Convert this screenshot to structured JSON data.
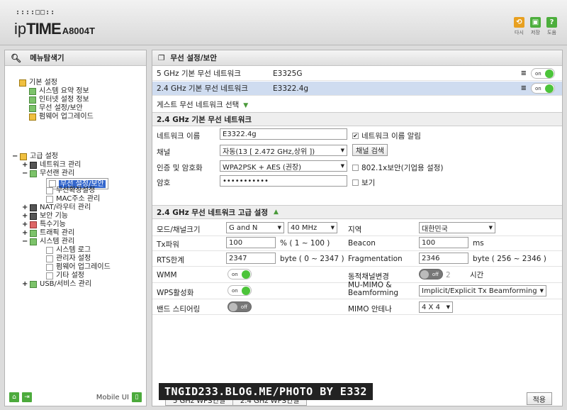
{
  "header": {
    "logo_mark": "::::□□::",
    "logo_brand_prefix": "ip",
    "logo_brand": "TIME",
    "logo_model": "A8004T",
    "buttons": [
      {
        "label": "다시",
        "icon": "refresh-icon",
        "color": "#e8a020"
      },
      {
        "label": "저장",
        "icon": "save-icon",
        "color": "#4cae3c"
      },
      {
        "label": "도움",
        "icon": "help-icon",
        "color": "#4cae3c"
      }
    ]
  },
  "sidebar": {
    "title": "메뉴탐색기",
    "items": [
      {
        "label": "기본 설정",
        "toggle": ""
      },
      {
        "label": "시스템 요약 정보"
      },
      {
        "label": "인터넷 설정 정보"
      },
      {
        "label": "무선 설정/보안"
      },
      {
        "label": "펌웨어 업그레이드"
      },
      {
        "label": "고급 설정",
        "toggle": "−"
      },
      {
        "label": "네트워크 관리",
        "toggle": "+"
      },
      {
        "label": "무선랜 관리",
        "toggle": "−"
      },
      {
        "label": "무선 설정/보안"
      },
      {
        "label": "무선확장설정"
      },
      {
        "label": "MAC주소 관리"
      },
      {
        "label": "NAT/라우터 관리",
        "toggle": "+"
      },
      {
        "label": "보안 기능",
        "toggle": "+"
      },
      {
        "label": "특수기능",
        "toggle": "+"
      },
      {
        "label": "트래픽 관리",
        "toggle": "+"
      },
      {
        "label": "시스템 관리",
        "toggle": "−"
      },
      {
        "label": "시스템 로그"
      },
      {
        "label": "관리자 설정"
      },
      {
        "label": "펌웨어 업그레이드"
      },
      {
        "label": "기타 설정"
      },
      {
        "label": "USB/서비스 관리",
        "toggle": "+"
      }
    ],
    "footer": {
      "mobile_label": "Mobile UI"
    }
  },
  "main": {
    "title": "무선 설정/보안",
    "networks": [
      {
        "band": "5 GHz 기본 무선 네트워크",
        "ssid": "E3325G",
        "toggle": "on"
      },
      {
        "band": "2.4 GHz 기본 무선 네트워크",
        "ssid": "E3322.4g",
        "toggle": "on"
      }
    ],
    "guest_label": "게스트 무선 네트워크 선택",
    "basic_section": {
      "title": "2.4 GHz 기본 무선 네트워크",
      "name_label": "네트워크 이름",
      "name_value": "E3322.4g",
      "broadcast_label": "네트워크 이름 알림",
      "channel_label": "채널",
      "channel_value": "자동(13 [ 2.472 GHz,상위 ])",
      "channel_search_btn": "채널 검색",
      "auth_label": "인증 및 암호화",
      "auth_value": "WPA2PSK + AES (권장)",
      "dot1x_label": "802.1x보안(기업용 설정)",
      "pw_label": "암호",
      "pw_value": "•••••••••••",
      "show_label": "보기"
    },
    "advanced_section": {
      "title": "2.4 GHz 무선 네트워크 고급 설정",
      "mode_label": "모드/채널크기",
      "mode_value": "G and N",
      "width_value": "40 MHz",
      "region_label": "지역",
      "region_value": "대한민국",
      "tx_label": "Tx파워",
      "tx_value": "100",
      "tx_range": "% ( 1 ~ 100 )",
      "beacon_label": "Beacon",
      "beacon_value": "100",
      "beacon_unit": "ms",
      "rts_label": "RTS한계",
      "rts_value": "2347",
      "rts_range": "byte ( 0 ~ 2347 )",
      "frag_label": "Fragmentation",
      "frag_value": "2346",
      "frag_range": "byte ( 256 ~ 2346 )",
      "wmm_label": "WMM",
      "wmm_state": "on",
      "dyn_label": "동적채널변경",
      "dyn_state": "off",
      "dyn_value": "2",
      "dyn_unit": "시간",
      "wps_label": "WPS활성화",
      "wps_state": "on",
      "mumimo_label1": "MU-MIMO &",
      "mumimo_label2": "Beamforming",
      "mumimo_value": "Implicit/Explicit Tx Beamforming",
      "band_label": "밴드 스티어링",
      "band_state": "off",
      "mimo_label": "MIMO 안테나",
      "mimo_value": "4 X 4"
    },
    "bottom_tabs": [
      "5 GHz WPS연결",
      "2.4 GHz WPS연결"
    ],
    "apply_label": "적용"
  },
  "watermark": "TNGID233.BLOG.ME/PHOTO BY E332"
}
